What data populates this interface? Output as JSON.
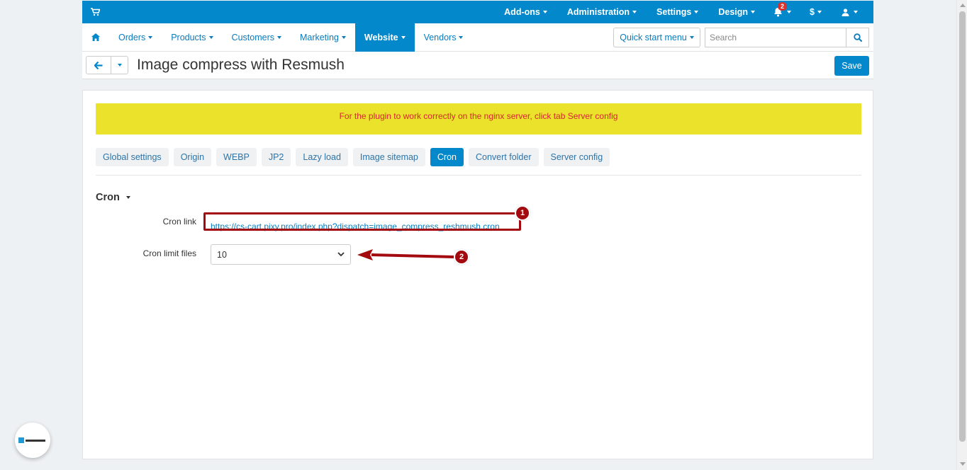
{
  "topbar": {
    "cart_icon": "cart-icon",
    "menus": [
      {
        "label": "Add-ons"
      },
      {
        "label": "Administration"
      },
      {
        "label": "Settings"
      },
      {
        "label": "Design"
      }
    ],
    "notifications_count": "2",
    "currency_label": "$",
    "bell_icon": "bell-icon",
    "user_icon": "user-icon"
  },
  "navbar": {
    "home_icon": "home-icon",
    "items": [
      {
        "label": "Orders"
      },
      {
        "label": "Products"
      },
      {
        "label": "Customers"
      },
      {
        "label": "Marketing"
      },
      {
        "label": "Website"
      },
      {
        "label": "Vendors"
      }
    ],
    "active_index": 4,
    "quick_start_label": "Quick start menu",
    "search_placeholder": "Search"
  },
  "titlebar": {
    "title": "Image compress with Resmush",
    "save_label": "Save"
  },
  "content": {
    "notice": "For the plugin to work correctly on the nginx server, click tab Server config",
    "tabs": [
      {
        "label": "Global settings"
      },
      {
        "label": "Origin"
      },
      {
        "label": "WEBP"
      },
      {
        "label": "JP2"
      },
      {
        "label": "Lazy load"
      },
      {
        "label": "Image sitemap"
      },
      {
        "label": "Cron"
      },
      {
        "label": "Convert folder"
      },
      {
        "label": "Server config"
      }
    ],
    "active_tab_index": 6,
    "section_title": "Cron",
    "cron_link_label": "Cron link",
    "cron_link_value": "https://cs-cart.pixy.pro/index.php?dispatch=image_compress_reshmush.cron",
    "cron_limit_label": "Cron limit files",
    "cron_limit_value": "10"
  },
  "annotations": {
    "marker_1": "1",
    "marker_2": "2",
    "color": "#a30a0f"
  },
  "colors": {
    "brand": "#0388cc",
    "notice_bg": "#ebe22c",
    "notice_text": "#d7262e"
  }
}
